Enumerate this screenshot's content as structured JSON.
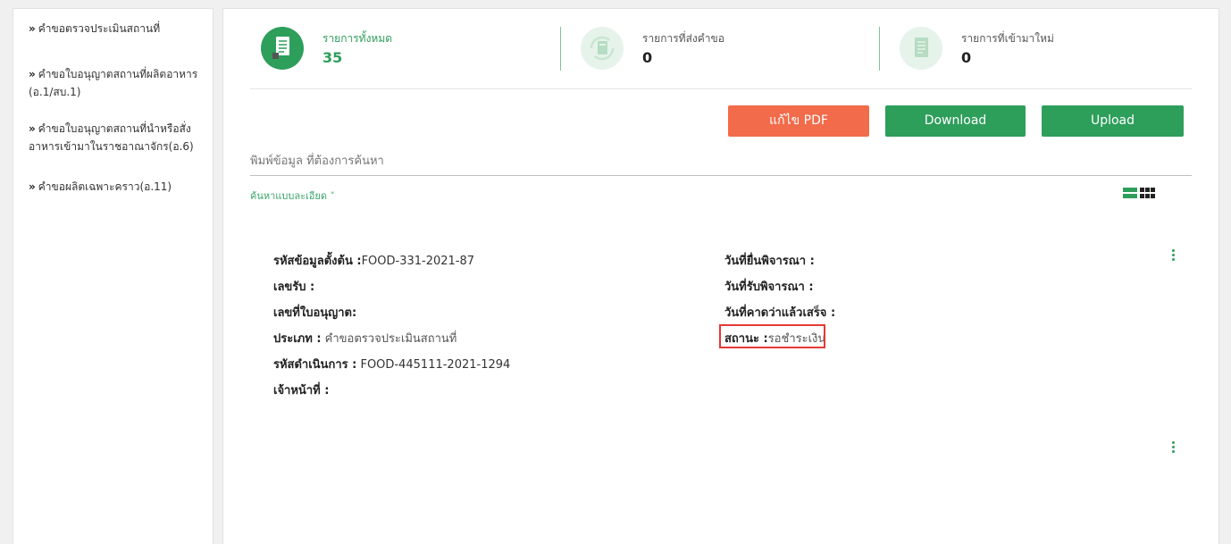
{
  "sidebar": {
    "items": [
      {
        "label": "คำขอตรวจประเมินสถานที่"
      },
      {
        "label": "คำขอใบอนุญาตสถานที่ผลิตอาหาร (อ.1/สบ.1)"
      },
      {
        "label": "คำขอใบอนุญาตสถานที่นำหรือสั่งอาหารเข้ามาในราชอาณาจักร(อ.6)"
      },
      {
        "label": "คำขอผลิตเฉพาะคราว(อ.11)"
      }
    ]
  },
  "stats": [
    {
      "label": "รายการทั้งหมด",
      "value": "35"
    },
    {
      "label": "รายการที่ส่งคำขอ",
      "value": "0"
    },
    {
      "label": "รายการที่เข้ามาใหม่",
      "value": "0"
    }
  ],
  "buttons": {
    "edit_pdf": "แก้ไข PDF",
    "download": "Download",
    "upload": "Upload"
  },
  "search": {
    "placeholder": "พิมพ์ข้อมูล ที่ต้องการค้นหา"
  },
  "advanced_search": "ค้นหาแบบละเอียด ˅",
  "record": {
    "origin_code_label": "รหัสข้อมูลตั้งต้น :",
    "origin_code_value": "FOOD-331-2021-87",
    "receipt_no_label": "เลขรับ :",
    "license_no_label": "เลขที่ใบอนุญาต:",
    "type_label": "ประเภท :",
    "type_value": " คำขอตรวจประเมินสถานที่",
    "process_code_label": "รหัสดำเนินการ :",
    "process_code_value": " FOOD-445111-2021-1294",
    "officer_label": "เจ้าหน้าที่ :",
    "submit_date_label": "วันที่ยื่นพิจารณา :",
    "accept_date_label": "วันที่รับพิจารณา :",
    "expected_date_label": "วันที่คาดว่าแล้วเสร็จ :",
    "status_label": "สถานะ :",
    "status_value": "รอชำระเงิน"
  },
  "colors": {
    "green": "#2e9e5b",
    "orange": "#f26b4a",
    "red_outline": "#e53935"
  },
  "icons": [
    "document-icon",
    "refresh-document-icon",
    "new-document-icon",
    "list-view-icon",
    "grid-view-icon",
    "kebab-menu-icon"
  ]
}
